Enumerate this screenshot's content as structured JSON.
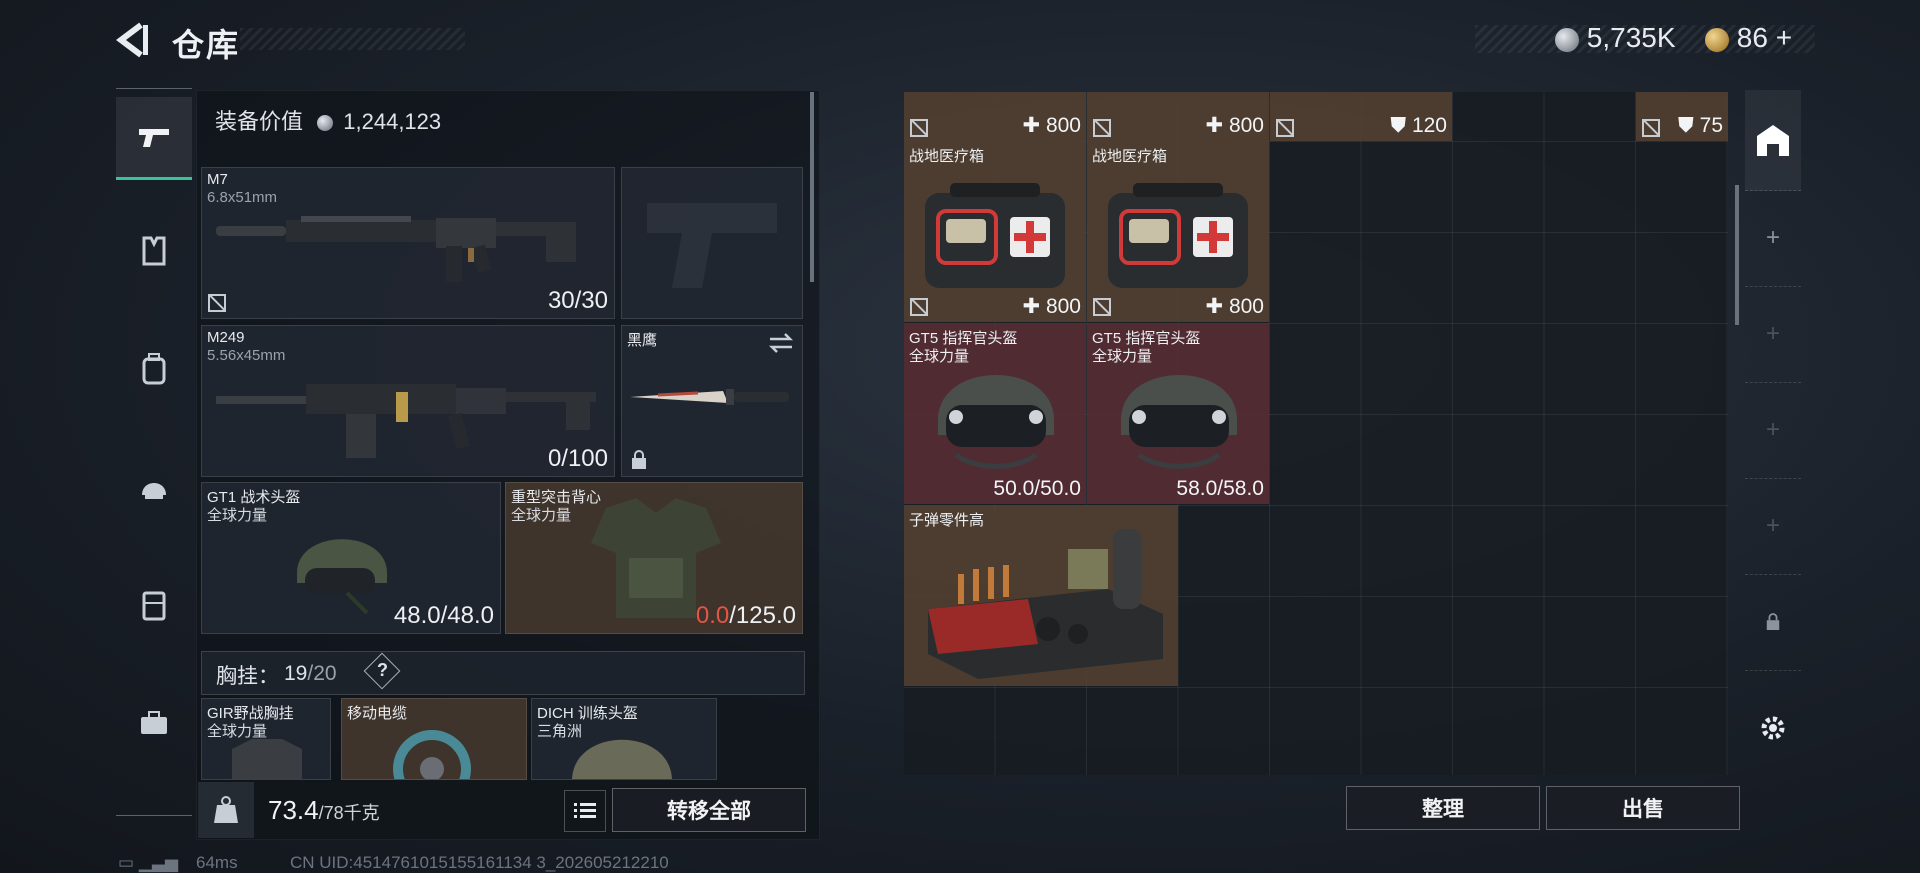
{
  "header": {
    "title": "仓库",
    "silver": "5,735K",
    "gold": "86",
    "gold_add": "+"
  },
  "left": {
    "equip_label": "装备价值",
    "equip_value": "1,244,123",
    "primary": {
      "name": "M7",
      "caliber": "6.8x51mm",
      "ammo": "30/30"
    },
    "secondary": {
      "name": "M249",
      "caliber": "5.56x45mm",
      "ammo": "0/100"
    },
    "melee": {
      "name": "黑鹰"
    },
    "helmet": {
      "name": "GT1 战术头盔",
      "sub": "全球力量",
      "dur": "48.0/48.0"
    },
    "armor": {
      "name": "重型突击背心",
      "sub": "全球力量",
      "dur_cur": "0.0",
      "dur_max": "/125.0"
    },
    "vest": {
      "label": "胸挂：",
      "used": "19",
      "sep": "/",
      "total": "20",
      "help": "?"
    },
    "items": [
      {
        "name": "GIR野战胸挂",
        "sub": "全球力量"
      },
      {
        "name": "移动电缆",
        "sub": ""
      },
      {
        "name": "DICH 训练头盔",
        "sub": "三角洲"
      }
    ],
    "weight": "73.4",
    "weight_max": "/78千克",
    "transfer_all": "转移全部"
  },
  "right": {
    "top_row": [
      {
        "value": "800",
        "kind": "heal"
      },
      {
        "value": "800",
        "kind": "heal"
      },
      {
        "value": "120",
        "kind": "armor"
      },
      {
        "value": "75",
        "kind": "armor"
      }
    ],
    "medkits": [
      {
        "name": "战地医疗箱",
        "value": "800"
      },
      {
        "name": "战地医疗箱",
        "value": "800"
      }
    ],
    "helmets": [
      {
        "name": "GT5 指挥官头盔",
        "sub": "全球力量",
        "dur": "50.0/50.0"
      },
      {
        "name": "GT5 指挥官头盔",
        "sub": "全球力量",
        "dur": "58.0/58.0"
      }
    ],
    "parts": {
      "name": "子弹零件高"
    },
    "sort": "整理",
    "sell": "出售"
  },
  "footer": {
    "ping": "64ms",
    "uid": "CN UID:4514761015155161134 3_202605212210"
  },
  "colors": {
    "accent": "#38c49a",
    "brown_slot": "#52403a",
    "red_slot": "#582c34",
    "damage": "#e0564a"
  }
}
